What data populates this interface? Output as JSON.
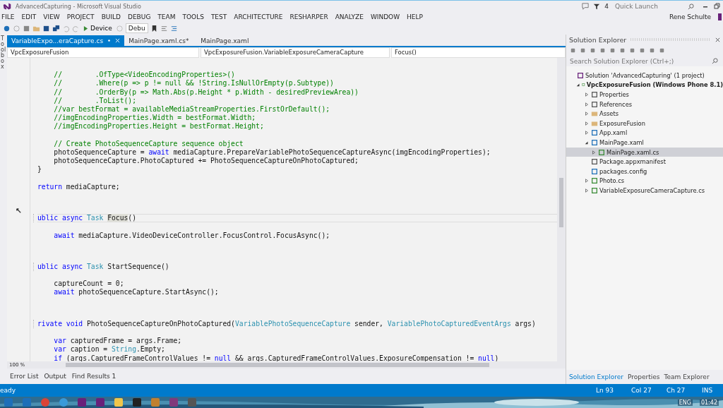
{
  "window": {
    "title": "AdvancedCapturing - Microsoft Visual Studio",
    "notifications": "4",
    "quick_launch": {
      "placeholder": "Quick Launch"
    },
    "user": "Rene Schulte"
  },
  "menu": [
    "FILE",
    "EDIT",
    "VIEW",
    "PROJECT",
    "BUILD",
    "DEBUG",
    "TEAM",
    "TOOLS",
    "TEST",
    "ARCHITECTURE",
    "RESHARPER",
    "ANALYZE",
    "WINDOW",
    "HELP"
  ],
  "toolbar": {
    "run_target": "Device",
    "configuration": "Debu"
  },
  "side_tab": "Toolbox",
  "document_tabs": [
    {
      "label": "VariableExpo...eraCapture.cs",
      "selected": true
    },
    {
      "label": "MainPage.xaml.cs*",
      "selected": false
    },
    {
      "label": "MainPage.xaml",
      "selected": false
    }
  ],
  "navigation": [
    "VpcExposureFusion",
    "VpcExposureFusion.VariableExposureCameraCapture",
    "Focus()"
  ],
  "code_blocks": [
    {
      "kind": "body",
      "lines": [
        {
          "tokens": [
            {
              "kind": "comment",
              "text": "    //        .OfType<VideoEncodingProperties>()"
            }
          ]
        },
        {
          "tokens": [
            {
              "kind": "comment",
              "text": "    //        .Where(p => p != null && !String.IsNullOrEmpty(p.Subtype))"
            }
          ]
        },
        {
          "tokens": [
            {
              "kind": "comment",
              "text": "    //        .OrderBy(p => Math.Abs(p.Height * p.Width - desiredPreviewArea))"
            }
          ]
        },
        {
          "tokens": [
            {
              "kind": "comment",
              "text": "    //        .ToList();"
            }
          ]
        },
        {
          "tokens": [
            {
              "kind": "comment",
              "text": "    //var bestFormat = availableMediaStreamProperties.FirstOrDefault();"
            }
          ]
        },
        {
          "tokens": [
            {
              "kind": "comment",
              "text": "    //imgEncodingProperties.Width = bestFormat.Width;"
            }
          ]
        },
        {
          "tokens": [
            {
              "kind": "comment",
              "text": "    //imgEncodingProperties.Height = bestFormat.Height;"
            }
          ]
        }
      ]
    },
    {
      "kind": "body",
      "lines": [
        {
          "tokens": [
            {
              "kind": "comment",
              "text": "    // Create PhotoSequenceCapture sequence object"
            }
          ]
        },
        {
          "tokens": [
            {
              "kind": "plain",
              "text": "    photoSequenceCapture = "
            },
            {
              "kind": "keyword",
              "text": "await"
            },
            {
              "kind": "plain",
              "text": " mediaCapture.PrepareVariablePhotoSequenceCaptureAsync(imgEncodingProperties);"
            }
          ]
        },
        {
          "tokens": [
            {
              "kind": "plain",
              "text": "    photoSequenceCapture.PhotoCaptured += PhotoSequenceCaptureOnPhotoCaptured;"
            }
          ]
        },
        {
          "tokens": [
            {
              "kind": "plain",
              "text": "}"
            }
          ]
        }
      ]
    },
    {
      "kind": "body",
      "lines": [
        {
          "tokens": [
            {
              "kind": "keyword",
              "text": "return"
            },
            {
              "kind": "plain",
              "text": " mediaCapture;"
            }
          ]
        }
      ]
    },
    {
      "kind": "member",
      "lines": [
        {
          "current": true,
          "tokens": [
            {
              "kind": "keyword",
              "text": "ublic async"
            },
            {
              "kind": "type",
              "text": " Task "
            },
            {
              "kind": "highlight",
              "text": "Focus"
            },
            {
              "kind": "plain",
              "text": "()"
            }
          ]
        }
      ]
    },
    {
      "kind": "body",
      "lines": [
        {
          "current": false,
          "tokens": [
            {
              "kind": "keyword",
              "text": "    await"
            },
            {
              "kind": "plain",
              "text": " mediaCapture.VideoDeviceController.FocusControl.FocusAsync();"
            }
          ]
        }
      ]
    },
    {
      "kind": "member",
      "lines": [
        {
          "current": false,
          "tokens": [
            {
              "kind": "keyword",
              "text": "ublic async"
            },
            {
              "kind": "type",
              "text": " Task"
            },
            {
              "kind": "plain",
              "text": " StartSequence()"
            }
          ]
        }
      ]
    },
    {
      "kind": "body",
      "lines": [
        {
          "tokens": [
            {
              "kind": "plain",
              "text": "    captureCount = 0;"
            }
          ]
        },
        {
          "tokens": [
            {
              "kind": "keyword",
              "text": "    await"
            },
            {
              "kind": "plain",
              "text": " photoSequenceCapture.StartAsync();"
            }
          ]
        }
      ]
    },
    {
      "kind": "member",
      "lines": [
        {
          "current": false,
          "tokens": [
            {
              "kind": "keyword",
              "text": "rivate void"
            },
            {
              "kind": "plain",
              "text": " PhotoSequenceCaptureOnPhotoCaptured("
            },
            {
              "kind": "type",
              "text": "VariablePhotoSequenceCapture"
            },
            {
              "kind": "plain",
              "text": " sender, "
            },
            {
              "kind": "type",
              "text": "VariablePhotoCapturedEventArgs"
            },
            {
              "kind": "plain",
              "text": " args)"
            }
          ]
        }
      ]
    },
    {
      "kind": "body",
      "lines": [
        {
          "tokens": [
            {
              "kind": "keyword",
              "text": "    var"
            },
            {
              "kind": "plain",
              "text": " capturedFrame = args.Frame;"
            }
          ]
        },
        {
          "tokens": [
            {
              "kind": "keyword",
              "text": "    var"
            },
            {
              "kind": "plain",
              "text": " caption = "
            },
            {
              "kind": "type",
              "text": "String"
            },
            {
              "kind": "plain",
              "text": ".Empty;"
            }
          ]
        },
        {
          "tokens": [
            {
              "kind": "keyword",
              "text": "    if"
            },
            {
              "kind": "plain",
              "text": " (args.CapturedFrameControlValues != "
            },
            {
              "kind": "keyword",
              "text": "null"
            },
            {
              "kind": "plain",
              "text": " && args.CapturedFrameControlValues.ExposureCompensation != "
            },
            {
              "kind": "keyword",
              "text": "null"
            },
            {
              "kind": "plain",
              "text": ")"
            }
          ]
        }
      ]
    }
  ],
  "zoom": "100 %",
  "output_tabs": [
    "Error List",
    "Output",
    "Find Results 1"
  ],
  "solution_explorer": {
    "title": "Solution Explorer",
    "search": {
      "placeholder": "Search Solution Explorer (Ctrl+;)"
    },
    "tree": [
      {
        "label": "Solution 'AdvancedCapturing' (1 project)",
        "kind": "solution",
        "selected": false,
        "children": [
          {
            "label": "VpcExposureFusion (Windows Phone 8.1)",
            "kind": "project",
            "expanded": true,
            "selected": false,
            "children": [
              {
                "label": "Properties",
                "kind": "properties",
                "expanded": false,
                "selected": false
              },
              {
                "label": "References",
                "kind": "references",
                "expanded": false,
                "selected": false
              },
              {
                "label": "Assets",
                "kind": "folder",
                "expanded": false,
                "selected": false
              },
              {
                "label": "ExposureFusion",
                "kind": "folder",
                "expanded": false,
                "selected": false
              },
              {
                "label": "App.xaml",
                "kind": "xaml",
                "expanded": false,
                "selected": false
              },
              {
                "label": "MainPage.xaml",
                "kind": "xaml",
                "expanded": true,
                "selected": false,
                "children": [
                  {
                    "label": "MainPage.xaml.cs",
                    "kind": "cs",
                    "expanded": false,
                    "selected": true
                  }
                ]
              },
              {
                "label": "Package.appxmanifest",
                "kind": "manifest",
                "selected": false
              },
              {
                "label": "packages.config",
                "kind": "config",
                "selected": false
              },
              {
                "label": "Photo.cs",
                "kind": "cs",
                "expanded": false,
                "selected": false
              },
              {
                "label": "VariableExposureCameraCapture.cs",
                "kind": "cs",
                "expanded": false,
                "selected": false
              }
            ]
          }
        ]
      }
    ]
  },
  "panel_tabs": [
    {
      "label": "Solution Explorer",
      "selected": true
    },
    {
      "label": "Properties",
      "selected": false
    },
    {
      "label": "Team Explorer",
      "selected": false
    }
  ],
  "status_bar": {
    "message": "eady",
    "line": "Ln 93",
    "column": "Col 27",
    "char": "Ch 27",
    "mode": "INS"
  },
  "taskbar": {
    "language": "ENG",
    "time": "01:42"
  }
}
